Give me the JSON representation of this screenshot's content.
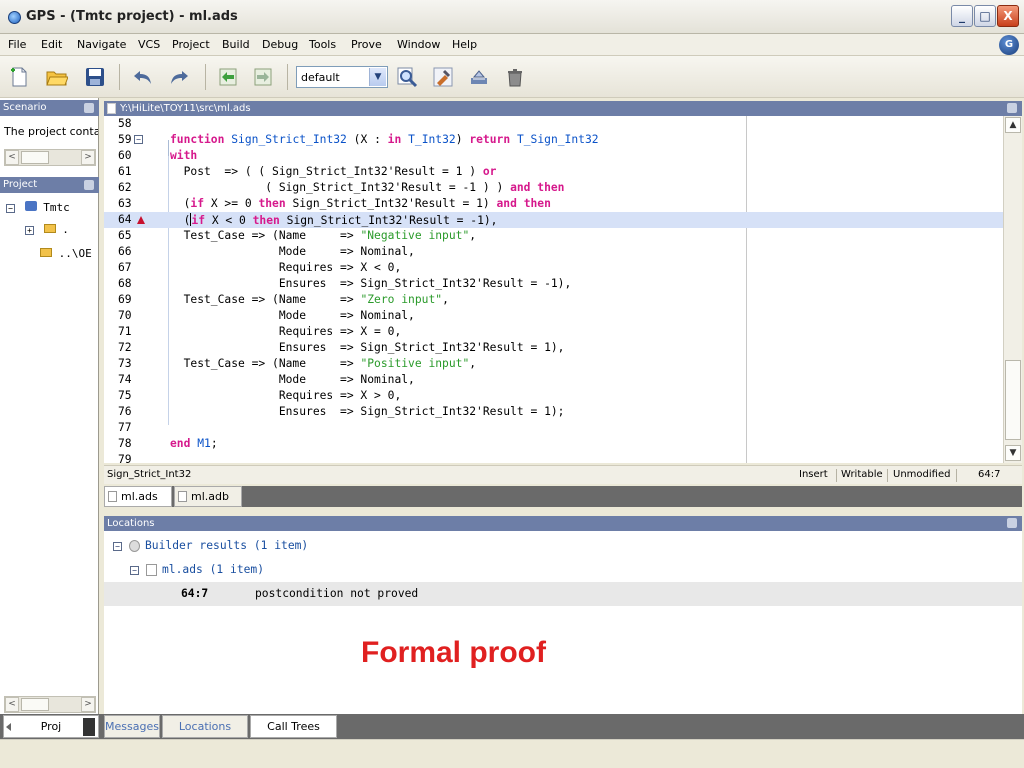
{
  "window": {
    "title": "GPS - (Tmtc project) - ml.ads",
    "min_label": "_",
    "max_label": "□",
    "close_label": "X"
  },
  "menubar": {
    "items": [
      "File",
      "Edit",
      "Navigate",
      "VCS",
      "Project",
      "Build",
      "Debug",
      "Tools",
      "Prove",
      "Window",
      "Help"
    ],
    "logo": "G"
  },
  "toolbar": {
    "icons": [
      "new-file-icon",
      "open-folder-icon",
      "save-icon",
      "undo-icon",
      "redo-icon",
      "back-icon",
      "forward-icon",
      "search-icon",
      "build-icon",
      "build-all-icon",
      "clean-icon"
    ],
    "combo_value": "default"
  },
  "left_panel": {
    "scenario_title": "Scenario",
    "scenario_text": "The project conta",
    "project_title": "Project",
    "tree": [
      {
        "label": "Tmtc",
        "level": 0
      },
      {
        "label": ".",
        "level": 1
      },
      {
        "label": "..\\OE",
        "level": 2
      }
    ],
    "proj_tab": "Proj"
  },
  "editor": {
    "path": "Y:\\HiLite\\TOY11\\src\\ml.ads",
    "lines": [
      {
        "n": "58",
        "html": ""
      },
      {
        "n": "59",
        "html": "<span class=\"kw\">function</span> <span class=\"ty\">Sign_Strict_Int32</span> (X : <span class=\"kw\">in</span> <span class=\"ty\">T_Int32</span>) <span class=\"kw\">return</span> <span class=\"ty\">T_Sign_Int32</span>"
      },
      {
        "n": "60",
        "html": "<span class=\"kw\">with</span>"
      },
      {
        "n": "61",
        "html": "  Post  => ( ( Sign_Strict_Int32'Result = 1 ) <span class=\"kw\">or</span>"
      },
      {
        "n": "62",
        "html": "              ( Sign_Strict_Int32'Result = -1 ) ) <span class=\"kw\">and then</span>"
      },
      {
        "n": "63",
        "html": "  (<span class=\"kw\">if</span> X >= 0 <span class=\"kw\">then</span> Sign_Strict_Int32'Result = 1) <span class=\"kw\">and then</span>"
      },
      {
        "n": "64",
        "html": "  (<span class=\"cursor\"></span><span class=\"kw\">if</span> X < 0 <span class=\"kw\">then</span> Sign_Strict_Int32'Result = -1),"
      },
      {
        "n": "65",
        "html": "  Test_Case => (Name     => <span class=\"str\">\"Negative input\"</span>,"
      },
      {
        "n": "66",
        "html": "                Mode     => Nominal,"
      },
      {
        "n": "67",
        "html": "                Requires => X < 0,"
      },
      {
        "n": "68",
        "html": "                Ensures  => Sign_Strict_Int32'Result = -1),"
      },
      {
        "n": "69",
        "html": "  Test_Case => (Name     => <span class=\"str\">\"Zero input\"</span>,"
      },
      {
        "n": "70",
        "html": "                Mode     => Nominal,"
      },
      {
        "n": "71",
        "html": "                Requires => X = 0,"
      },
      {
        "n": "72",
        "html": "                Ensures  => Sign_Strict_Int32'Result = 1),"
      },
      {
        "n": "73",
        "html": "  Test_Case => (Name     => <span class=\"str\">\"Positive input\"</span>,"
      },
      {
        "n": "74",
        "html": "                Mode     => Nominal,"
      },
      {
        "n": "75",
        "html": "                Requires => X > 0,"
      },
      {
        "n": "76",
        "html": "                Ensures  => Sign_Strict_Int32'Result = 1);"
      },
      {
        "n": "77",
        "html": ""
      },
      {
        "n": "78",
        "html": "<span class=\"kw\">end</span> <span class=\"ty\">M1</span>;"
      },
      {
        "n": "79",
        "html": ""
      }
    ],
    "highlight_line": "64"
  },
  "statusbar": {
    "context": "Sign_Strict_Int32",
    "mode": "Insert",
    "writable": "Writable",
    "modified": "Unmodified",
    "position": "64:7"
  },
  "editor_tabs": [
    "ml.ads",
    "ml.adb"
  ],
  "locations": {
    "title": "Locations",
    "group": "Builder results (1 item)",
    "file": "ml.ads (1 item)",
    "message_pos": "64:7",
    "message_text": "postcondition not proved"
  },
  "overlay_text": "Formal proof",
  "bottom_tabs": [
    "Messages",
    "Locations",
    "Call Trees"
  ]
}
